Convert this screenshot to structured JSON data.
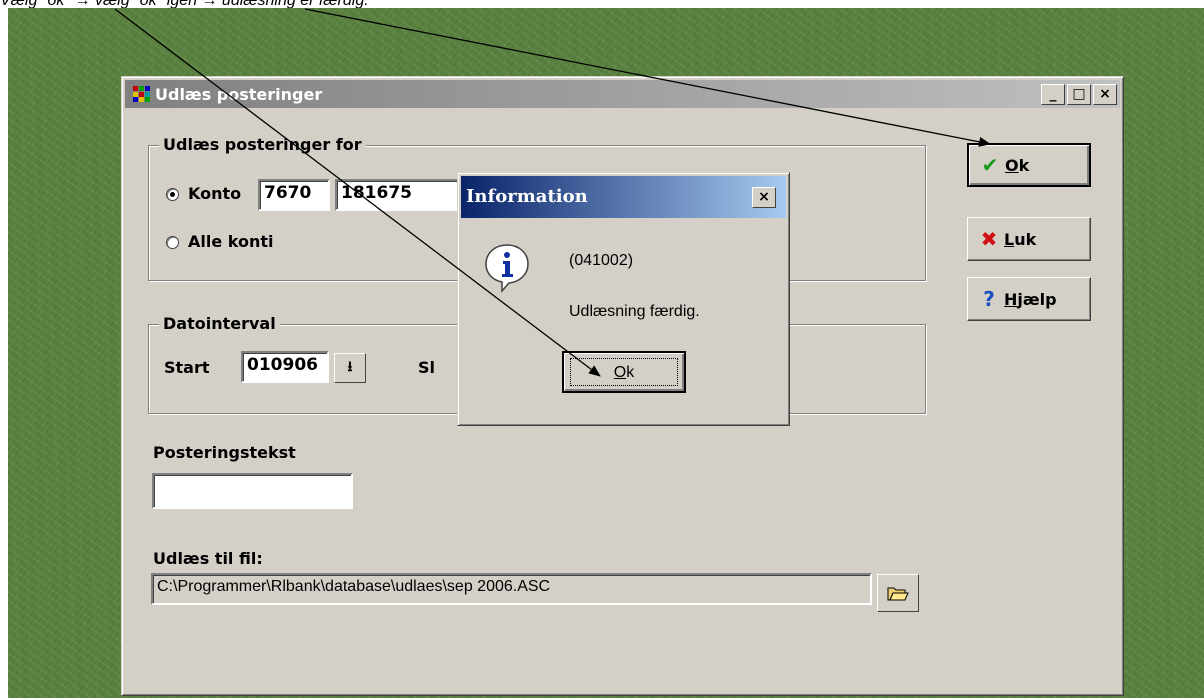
{
  "caption": "Vælg \"ok\" → vælg \"ok\" igen → udlæsning er færdig.",
  "window": {
    "title": "Udlæs posteringer",
    "controls": [
      "_",
      "□",
      "×"
    ]
  },
  "group_accounts": {
    "label": "Udlæs posteringer for",
    "konto_label": "Konto",
    "konto_reg": "7670",
    "konto_number": "181675",
    "alle_label": "Alle konti",
    "selected": "Konto"
  },
  "group_dates": {
    "label": "Datointerval",
    "start_label": "Start",
    "start_value": "010906",
    "slut_label_partial": "Sl"
  },
  "posting_text": {
    "label": "Posteringstekst",
    "value": ""
  },
  "export_file": {
    "label": "Udlæs til fil:",
    "path": "C:\\Programmer\\Rlbank\\database\\udlaes\\sep 2006.ASC"
  },
  "side_buttons": [
    {
      "key": "ok",
      "mnemonic": "O",
      "rest": "k",
      "icon": "check-icon"
    },
    {
      "key": "luk",
      "mnemonic": "L",
      "rest": "uk",
      "icon": "x-icon"
    },
    {
      "key": "help",
      "mnemonic": "H",
      "rest": "jælp",
      "icon": "question-icon"
    }
  ],
  "info_dialog": {
    "title": "Information",
    "code": "(041002)",
    "message": "Udlæsning færdig.",
    "ok_mnemonic": "O",
    "ok_rest": "k",
    "icon": "info-icon"
  }
}
